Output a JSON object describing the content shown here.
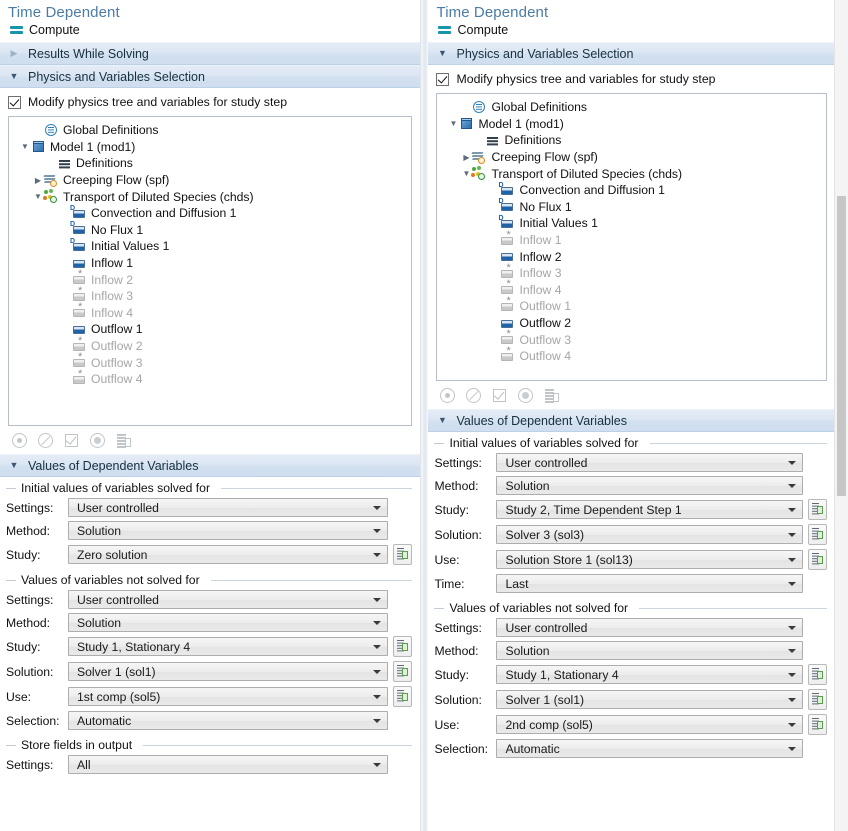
{
  "left": {
    "title": "Time Dependent",
    "compute": {
      "label": "Compute",
      "icon": "equals-icon"
    },
    "sections": [
      {
        "label": "Results While Solving",
        "expanded": false
      },
      {
        "label": "Physics and Variables Selection",
        "expanded": true
      }
    ],
    "modify_checkbox": {
      "label": "Modify physics tree and variables for study step",
      "checked": true
    },
    "tree": [
      {
        "label": "Global Definitions",
        "indent": 1,
        "arrow": "none",
        "icon": "global-definitions-icon",
        "dim": false
      },
      {
        "label": "Model 1 (mod1)",
        "indent": 0,
        "arrow": "down",
        "icon": "model-icon",
        "dim": false
      },
      {
        "label": "Definitions",
        "indent": 2,
        "arrow": "none",
        "icon": "definitions-icon",
        "dim": false
      },
      {
        "label": "Creeping Flow (spf)",
        "indent": 1,
        "arrow": "right",
        "icon": "creeping-flow-icon",
        "dim": false
      },
      {
        "label": "Transport of Diluted Species (chds)",
        "indent": 1,
        "arrow": "down",
        "icon": "transport-species-icon",
        "dim": false
      },
      {
        "label": "Convection and Diffusion 1",
        "indent": 3,
        "arrow": "none",
        "icon": "feature-d-icon",
        "dim": false
      },
      {
        "label": "No Flux 1",
        "indent": 3,
        "arrow": "none",
        "icon": "feature-d-icon",
        "dim": false
      },
      {
        "label": "Initial Values 1",
        "indent": 3,
        "arrow": "none",
        "icon": "feature-d-icon",
        "dim": false
      },
      {
        "label": "Inflow 1",
        "indent": 3,
        "arrow": "none",
        "icon": "feature-icon",
        "dim": false
      },
      {
        "label": "Inflow 2",
        "indent": 3,
        "arrow": "none",
        "icon": "feature-disabled-icon",
        "dim": true
      },
      {
        "label": "Inflow 3",
        "indent": 3,
        "arrow": "none",
        "icon": "feature-disabled-icon",
        "dim": true
      },
      {
        "label": "Inflow 4",
        "indent": 3,
        "arrow": "none",
        "icon": "feature-disabled-icon",
        "dim": true
      },
      {
        "label": "Outflow 1",
        "indent": 3,
        "arrow": "none",
        "icon": "feature-icon",
        "dim": false
      },
      {
        "label": "Outflow 2",
        "indent": 3,
        "arrow": "none",
        "icon": "feature-disabled-icon",
        "dim": true
      },
      {
        "label": "Outflow 3",
        "indent": 3,
        "arrow": "none",
        "icon": "feature-disabled-icon",
        "dim": true
      },
      {
        "label": "Outflow 4",
        "indent": 3,
        "arrow": "none",
        "icon": "feature-disabled-icon",
        "dim": true
      }
    ],
    "tree_toolbar": [
      {
        "name": "enable-icon"
      },
      {
        "name": "disable-icon"
      },
      {
        "name": "select-all-icon"
      },
      {
        "name": "solve-for-icon"
      },
      {
        "name": "report-icon"
      }
    ],
    "values_section": {
      "label": "Values of Dependent Variables",
      "expanded": true
    },
    "groups": [
      {
        "label": "Initial values of variables solved for",
        "fields": [
          {
            "label": "Settings:",
            "value": "User controlled",
            "source_button": false
          },
          {
            "label": "Method:",
            "value": "Solution",
            "source_button": false
          },
          {
            "label": "Study:",
            "value": "Zero solution",
            "source_button": true
          }
        ]
      },
      {
        "label": "Values of variables not solved for",
        "fields": [
          {
            "label": "Settings:",
            "value": "User controlled",
            "source_button": false
          },
          {
            "label": "Method:",
            "value": "Solution",
            "source_button": false
          },
          {
            "label": "Study:",
            "value": "Study 1, Stationary 4",
            "source_button": true
          },
          {
            "label": "Solution:",
            "value": "Solver 1 (sol1)",
            "source_button": true
          },
          {
            "label": "Use:",
            "value": "1st comp (sol5)",
            "source_button": true
          },
          {
            "label": "Selection:",
            "value": "Automatic",
            "source_button": false
          }
        ]
      },
      {
        "label": "Store fields in output",
        "fields": [
          {
            "label": "Settings:",
            "value": "All",
            "source_button": false
          }
        ]
      }
    ]
  },
  "right": {
    "title": "Time Dependent",
    "compute": {
      "label": "Compute",
      "icon": "equals-icon"
    },
    "sections": [
      {
        "label": "Physics and Variables Selection",
        "expanded": true
      }
    ],
    "modify_checkbox": {
      "label": "Modify physics tree and variables for study step",
      "checked": true
    },
    "tree": [
      {
        "label": "Global Definitions",
        "indent": 1,
        "arrow": "none",
        "icon": "global-definitions-icon",
        "dim": false
      },
      {
        "label": "Model 1 (mod1)",
        "indent": 0,
        "arrow": "down",
        "icon": "model-icon",
        "dim": false
      },
      {
        "label": "Definitions",
        "indent": 2,
        "arrow": "none",
        "icon": "definitions-icon",
        "dim": false
      },
      {
        "label": "Creeping Flow (spf)",
        "indent": 1,
        "arrow": "right",
        "icon": "creeping-flow-icon",
        "dim": false
      },
      {
        "label": "Transport of Diluted Species (chds)",
        "indent": 1,
        "arrow": "down",
        "icon": "transport-species-icon",
        "dim": false
      },
      {
        "label": "Convection and Diffusion 1",
        "indent": 3,
        "arrow": "none",
        "icon": "feature-d-icon",
        "dim": false
      },
      {
        "label": "No Flux 1",
        "indent": 3,
        "arrow": "none",
        "icon": "feature-d-icon",
        "dim": false
      },
      {
        "label": "Initial Values 1",
        "indent": 3,
        "arrow": "none",
        "icon": "feature-d-icon",
        "dim": false
      },
      {
        "label": "Inflow 1",
        "indent": 3,
        "arrow": "none",
        "icon": "feature-disabled-icon",
        "dim": true
      },
      {
        "label": "Inflow 2",
        "indent": 3,
        "arrow": "none",
        "icon": "feature-icon",
        "dim": false
      },
      {
        "label": "Inflow 3",
        "indent": 3,
        "arrow": "none",
        "icon": "feature-disabled-icon",
        "dim": true
      },
      {
        "label": "Inflow 4",
        "indent": 3,
        "arrow": "none",
        "icon": "feature-disabled-icon",
        "dim": true
      },
      {
        "label": "Outflow 1",
        "indent": 3,
        "arrow": "none",
        "icon": "feature-disabled-icon",
        "dim": true
      },
      {
        "label": "Outflow 2",
        "indent": 3,
        "arrow": "none",
        "icon": "feature-icon",
        "dim": false
      },
      {
        "label": "Outflow 3",
        "indent": 3,
        "arrow": "none",
        "icon": "feature-disabled-icon",
        "dim": true
      },
      {
        "label": "Outflow 4",
        "indent": 3,
        "arrow": "none",
        "icon": "feature-disabled-icon",
        "dim": true
      }
    ],
    "tree_toolbar": [
      {
        "name": "enable-icon"
      },
      {
        "name": "disable-icon"
      },
      {
        "name": "select-all-icon"
      },
      {
        "name": "solve-for-icon"
      },
      {
        "name": "report-icon"
      }
    ],
    "values_section": {
      "label": "Values of Dependent Variables",
      "expanded": true
    },
    "groups": [
      {
        "label": "Initial values of variables solved for",
        "fields": [
          {
            "label": "Settings:",
            "value": "User controlled",
            "source_button": false
          },
          {
            "label": "Method:",
            "value": "Solution",
            "source_button": false
          },
          {
            "label": "Study:",
            "value": "Study 2, Time Dependent Step 1",
            "source_button": true
          },
          {
            "label": "Solution:",
            "value": "Solver 3 (sol3)",
            "source_button": true
          },
          {
            "label": "Use:",
            "value": "Solution Store 1 (sol13)",
            "source_button": true
          },
          {
            "label": "Time:",
            "value": "Last",
            "source_button": false
          }
        ]
      },
      {
        "label": "Values of variables not solved for",
        "fields": [
          {
            "label": "Settings:",
            "value": "User controlled",
            "source_button": false
          },
          {
            "label": "Method:",
            "value": "Solution",
            "source_button": false
          },
          {
            "label": "Study:",
            "value": "Study 1, Stationary 4",
            "source_button": true
          },
          {
            "label": "Solution:",
            "value": "Solver 1 (sol1)",
            "source_button": true
          },
          {
            "label": "Use:",
            "value": "2nd comp (sol5)",
            "source_button": true
          },
          {
            "label": "Selection:",
            "value": "Automatic",
            "source_button": false
          }
        ]
      }
    ]
  },
  "colors": {
    "title": "#4b7ca6",
    "section_header": "#d6e3f2",
    "accent_teal": "#1496a8",
    "tree_active": "#1f62a8",
    "tree_disabled": "#a6a6a6",
    "source_green": "#5a9e4d"
  }
}
